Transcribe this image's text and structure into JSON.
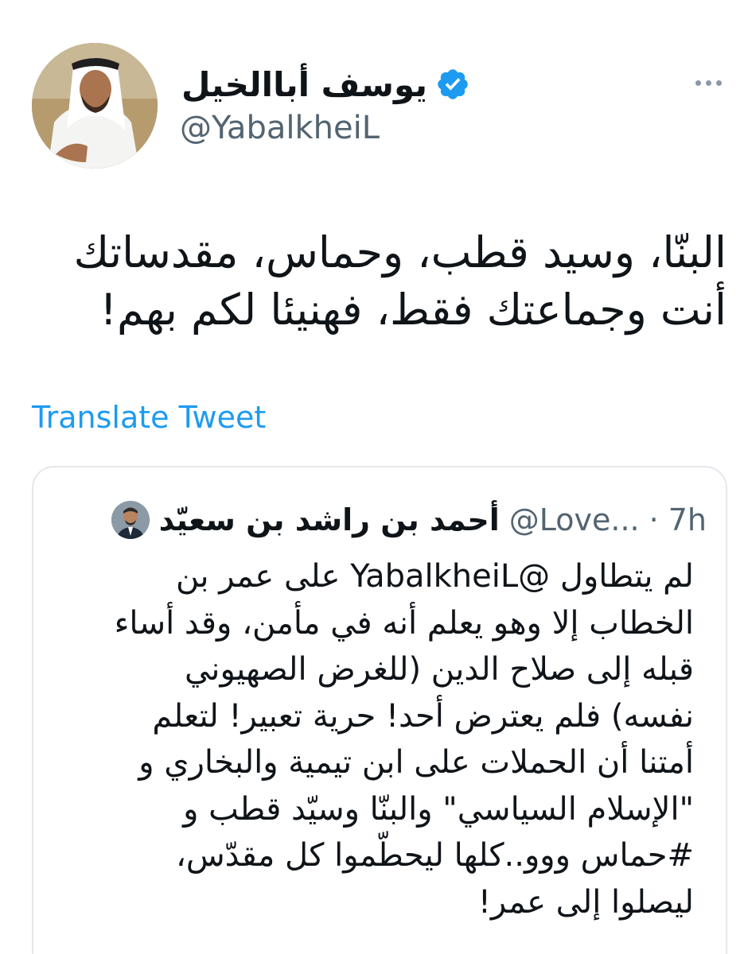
{
  "author": {
    "name": "يوسف أباالخيل",
    "handle": "@YabalkheiL",
    "verified": true,
    "avatar_icon": "profile-photo"
  },
  "more_icon": "more-horizontal-icon",
  "tweet": {
    "lines": [
      "البنّا، وسيد قطب، وحماس، مقدساتك",
      "أنت وجماعتك فقط، فهنيئا لكم بهم!"
    ]
  },
  "translate_label": "Translate Tweet",
  "quoted": {
    "name": "أحمد بن راشد بن سعيّد",
    "handle": "@Love...",
    "dot": "·",
    "time": "7h",
    "lines": [
      "لم يتطاول @YabalkheiL على عمر بن",
      "الخطاب إلا وهو يعلم أنه في مأمن، وقد أساء",
      "قبله إلى صلاح الدين (للغرض الصهيوني",
      "نفسه) فلم يعترض أحد! حرية تعبير! لتعلم",
      "أمتنا أن الحملات على ابن تيمية والبخاري و",
      "\"الإسلام السياسي\" والبنّا وسيّد قطب و",
      "#حماس ووو..كلها ليحطّموا كل مقدّس،",
      "ليصلوا إلى عمر!"
    ]
  },
  "colors": {
    "link": "#1d9bf0",
    "secondary_text": "#536471",
    "verified_badge": "#1d9bf0",
    "border": "#e4e8ec"
  }
}
